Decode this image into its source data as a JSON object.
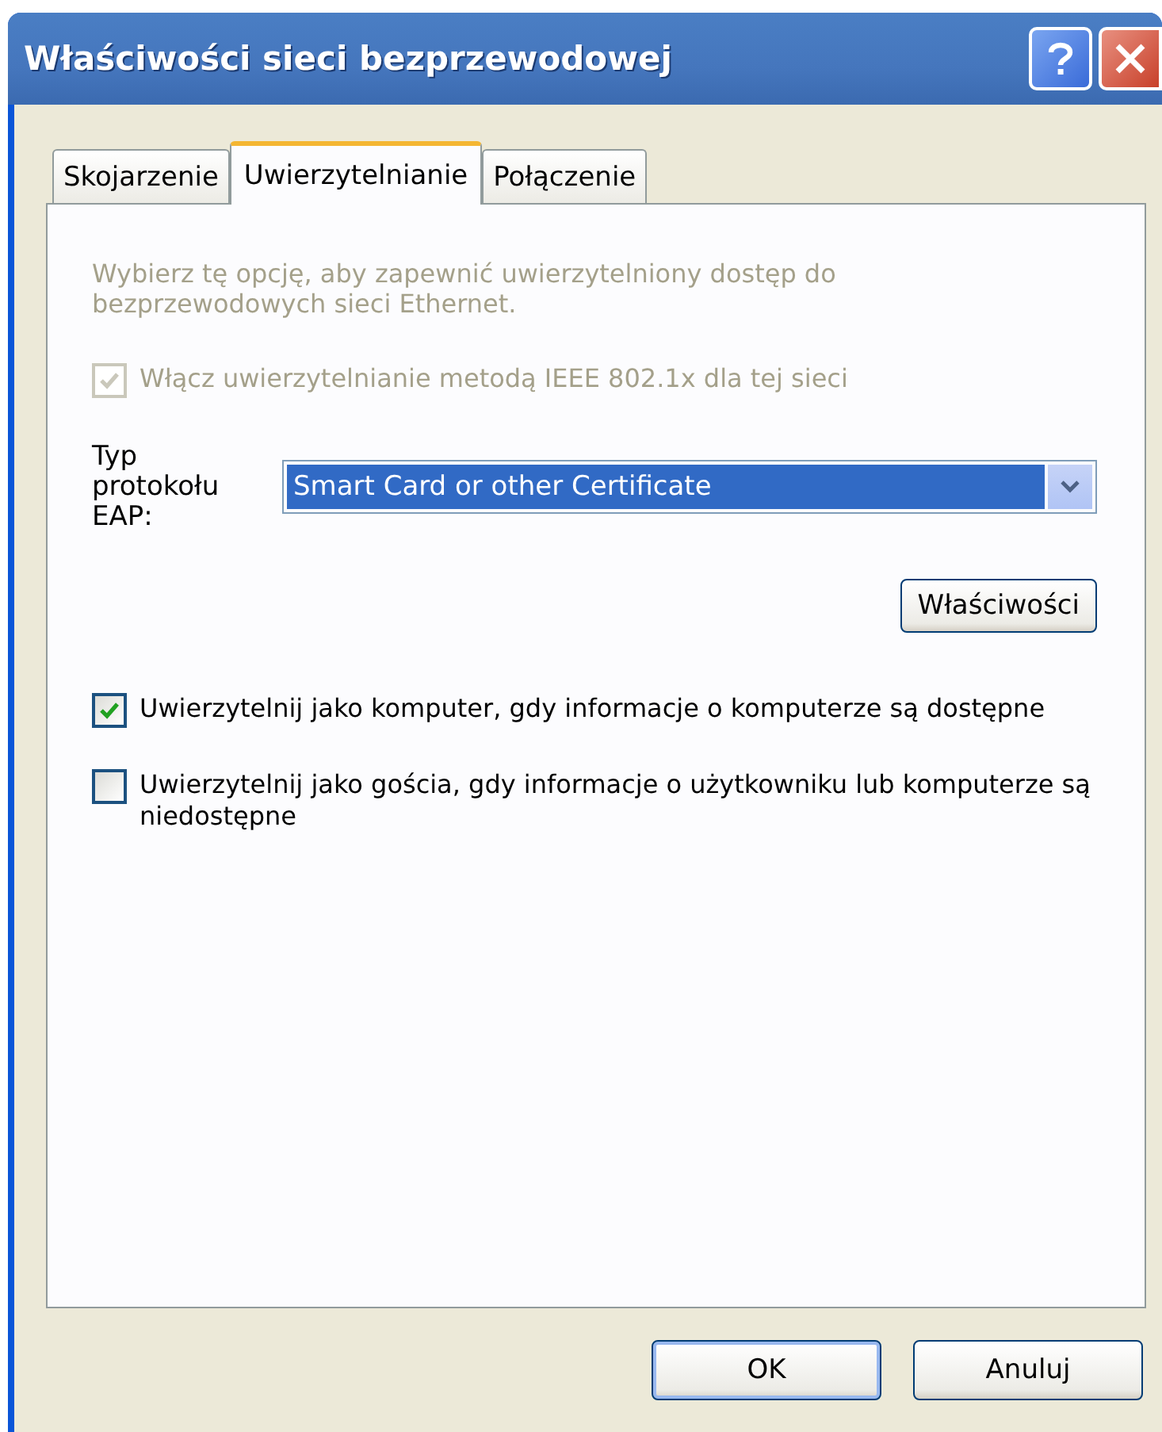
{
  "window": {
    "title": "Właściwości sieci bezprzewodowej"
  },
  "tabs": [
    {
      "label": "Skojarzenie",
      "selected": false
    },
    {
      "label": "Uwierzytelnianie",
      "selected": true
    },
    {
      "label": "Połączenie",
      "selected": false
    }
  ],
  "description": "Wybierz tę opcję, aby zapewnić uwierzytelniony dostęp do bezprzewodowych sieci Ethernet.",
  "enable_checkbox": {
    "label": "Włącz uwierzytelnianie metodą IEEE 802.1x dla tej sieci",
    "checked": true,
    "disabled": true
  },
  "eap_type": {
    "label": "Typ protokołu EAP:",
    "value": "Smart Card or other Certificate"
  },
  "properties_button": "Właściwości",
  "options": [
    {
      "label": "Uwierzytelnij jako komputer, gdy informacje o komputerze są dostępne",
      "checked": true,
      "disabled": false
    },
    {
      "label": "Uwierzytelnij jako gościa, gdy informacje o użytkowniku lub komputerze są niedostępne",
      "checked": false,
      "disabled": false
    }
  ],
  "buttons": [
    {
      "label": "OK",
      "default": true
    },
    {
      "label": "Anuluj",
      "default": false
    }
  ]
}
